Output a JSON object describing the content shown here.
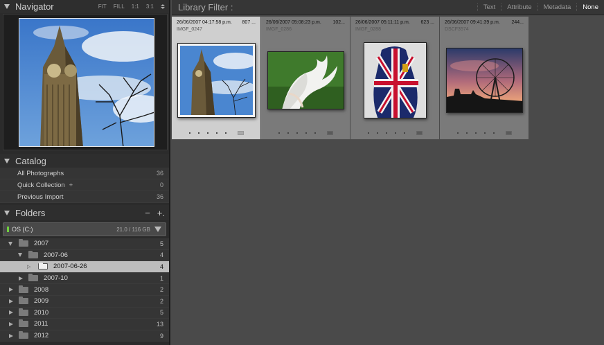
{
  "navigator": {
    "title": "Navigator",
    "zoom_options": [
      "FIT",
      "FILL",
      "1:1",
      "3:1"
    ]
  },
  "catalog": {
    "title": "Catalog",
    "items": [
      {
        "label": "All Photographs",
        "count": "36"
      },
      {
        "label": "Quick Collection",
        "count": "0",
        "suffix": "+"
      },
      {
        "label": "Previous Import",
        "count": "36"
      }
    ]
  },
  "folders": {
    "title": "Folders",
    "actions": {
      "remove": "−",
      "add": "+."
    },
    "volume": {
      "name": "OS (C:)",
      "info": "21.0 / 116 GB"
    },
    "tree": [
      {
        "name": "2007",
        "count": "5",
        "level": 0,
        "expanded": true
      },
      {
        "name": "2007-06",
        "count": "4",
        "level": 1,
        "expanded": true
      },
      {
        "name": "2007-06-26",
        "count": "4",
        "level": 2,
        "selected": true
      },
      {
        "name": "2007-10",
        "count": "1",
        "level": 1,
        "expanded": false
      },
      {
        "name": "2008",
        "count": "2",
        "level": 0,
        "expanded": false
      },
      {
        "name": "2009",
        "count": "2",
        "level": 0,
        "expanded": false
      },
      {
        "name": "2010",
        "count": "5",
        "level": 0,
        "expanded": false
      },
      {
        "name": "2011",
        "count": "13",
        "level": 0,
        "expanded": false
      },
      {
        "name": "2012",
        "count": "9",
        "level": 0,
        "expanded": false
      }
    ]
  },
  "filter_bar": {
    "label": "Library Filter :",
    "options": [
      "Text",
      "Attribute",
      "Metadata",
      "None"
    ],
    "active": "None"
  },
  "grid": [
    {
      "date": "26/06/2007 04:17:58 p.m.",
      "size": "807 ...",
      "file": "IMGF_0247",
      "selected": true,
      "subject": "clock-tower"
    },
    {
      "date": "26/06/2007 05:08:23 p.m.",
      "size": "102...",
      "file": "IMGF_0286",
      "selected": false,
      "subject": "white-bird"
    },
    {
      "date": "26/06/2007 05:11:11 p.m.",
      "size": "623 ...",
      "file": "IMGF_0288",
      "selected": false,
      "subject": "union-jack-coat"
    },
    {
      "date": "26/06/2007 09:41:39 p.m.",
      "size": "244...",
      "file": "DSCF3574",
      "selected": false,
      "subject": "ferris-wheel-sunset"
    }
  ]
}
